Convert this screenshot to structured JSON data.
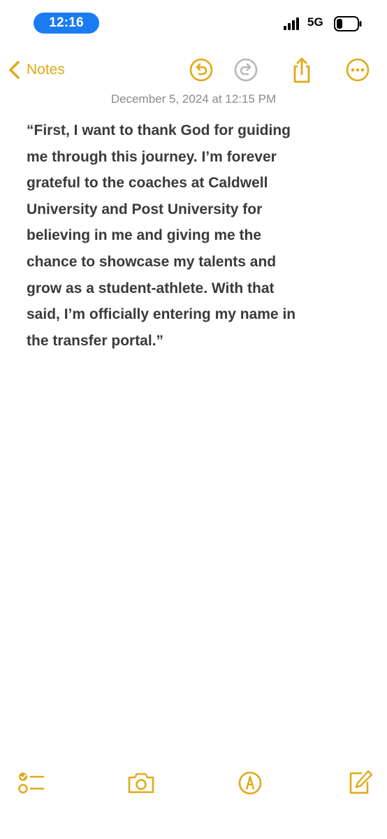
{
  "status_bar": {
    "time": "12:16",
    "network": "5G",
    "signal_icon": "cellular-signal-icon",
    "battery_icon": "battery-low-icon",
    "time_pill_color": "#1a7cf0"
  },
  "nav": {
    "back_label": "Notes",
    "accent_color": "#e1a917",
    "icons": [
      "chevron-left-icon",
      "undo-icon",
      "redo-icon",
      "share-icon",
      "more-icon"
    ]
  },
  "note": {
    "date": "December 5, 2024 at 12:15 PM",
    "lines": [
      "“First, I want to thank God for guiding",
      "me through this journey. I’m forever",
      "grateful to the coaches at Caldwell",
      "University and Post University for",
      "believing in me and giving me the",
      "chance to showcase my talents and",
      "grow as a student-athlete. With that",
      "said, I’m officially entering my name in",
      "the transfer portal.”"
    ]
  },
  "toolbar": {
    "icons": [
      "checklist-icon",
      "camera-icon",
      "markup-icon",
      "compose-icon"
    ]
  }
}
